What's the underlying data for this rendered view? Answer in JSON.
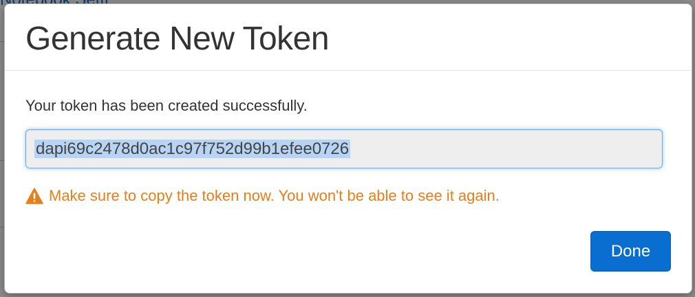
{
  "background": {
    "link_fragment": "Notebook Setti"
  },
  "modal": {
    "title": "Generate New Token",
    "success_message": "Your token has been created successfully.",
    "token_value": "dapi69c2478d0ac1c97f752d99b1efee0726",
    "warning_icon": "warning-triangle-icon",
    "warning_message": "Make sure to copy the token now. You won't be able to see it again.",
    "done_label": "Done"
  },
  "colors": {
    "accent": "#0a6dd0",
    "warning": "#e67e1a",
    "input_focus": "#66afe9"
  }
}
